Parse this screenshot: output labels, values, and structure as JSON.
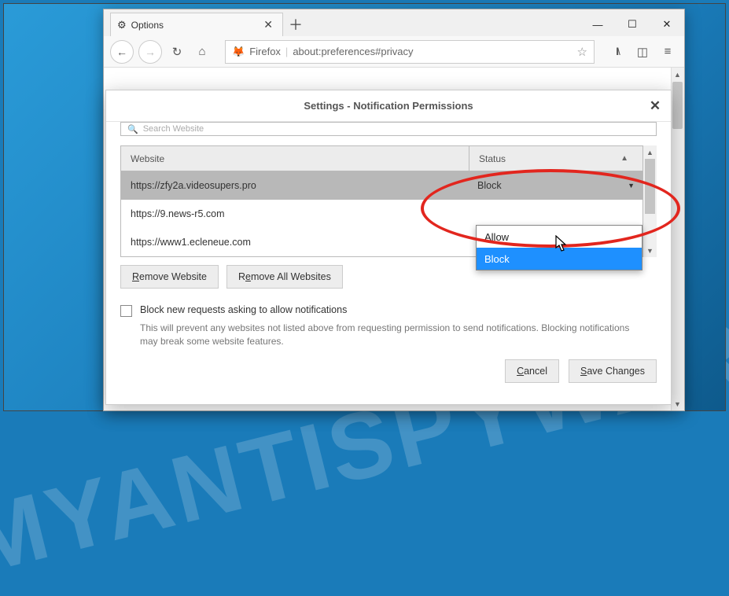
{
  "tab": {
    "title": "Options"
  },
  "url": {
    "scheme_label": "Firefox",
    "path": "about:preferences#privacy"
  },
  "modal": {
    "title": "Settings - Notification Permissions",
    "search_placeholder": "Search Website",
    "columns": {
      "website": "Website",
      "status": "Status"
    },
    "rows": [
      {
        "site": "https://zfy2a.videosupers.pro",
        "status": "Block"
      },
      {
        "site": "https://9.news-r5.com",
        "status": ""
      },
      {
        "site": "https://www1.ecleneue.com",
        "status": ""
      }
    ],
    "dropdown": {
      "options": [
        "Allow",
        "Block"
      ],
      "highlight_index": 1
    },
    "remove_one": "Remove Website",
    "remove_all": "Remove All Websites",
    "block_new_label": "Block new requests asking to allow notifications",
    "block_new_help": "This will prevent any websites not listed above from requesting permission to send notifications. Blocking notifications may break some website features.",
    "cancel": "Cancel",
    "save": "Save Changes"
  },
  "watermark": "MYANTISPYWARE.COM"
}
